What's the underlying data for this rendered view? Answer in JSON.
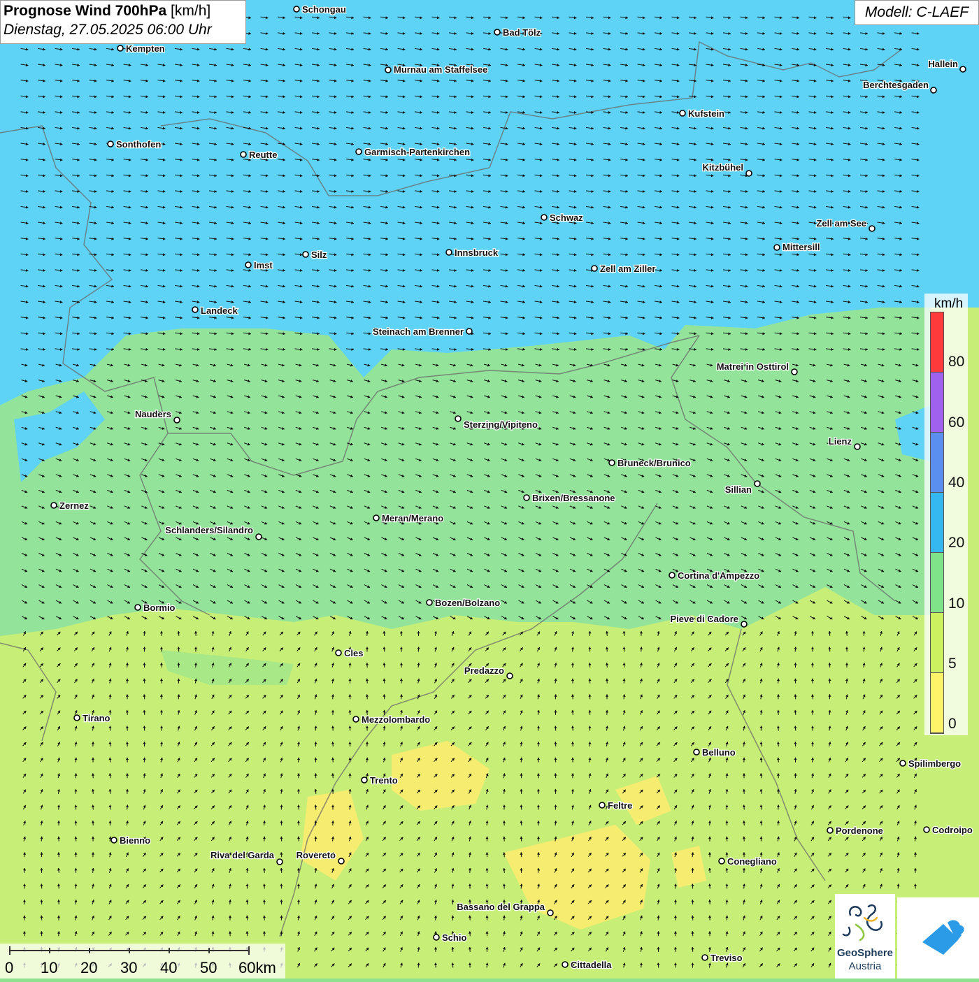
{
  "header": {
    "title_bold": "Prognose Wind 700hPa",
    "title_unit": "[km/h]",
    "datetime": "Dienstag, 27.05.2025 06:00 Uhr",
    "model": "Modell: C-LAEF"
  },
  "legend": {
    "unit": "km/h",
    "labels": [
      "80",
      "60",
      "40",
      "20",
      "10",
      "5",
      "0"
    ],
    "colors": [
      "#ff3a3a",
      "#a062ee",
      "#5a8ff0",
      "#35b8f0",
      "#7fe38a",
      "#cdf060",
      "#fff36a"
    ]
  },
  "scale_bar": {
    "labels": [
      "0",
      "10",
      "20",
      "30",
      "40",
      "50",
      "60km"
    ]
  },
  "cities": [
    {
      "name": "Schongau"
    },
    {
      "name": "Bad Tölz"
    },
    {
      "name": "Kempten"
    },
    {
      "name": "Murnau am Staffelsee"
    },
    {
      "name": "Hallein"
    },
    {
      "name": "Berchtesgaden"
    },
    {
      "name": "Kufstein"
    },
    {
      "name": "Sonthofen"
    },
    {
      "name": "Reutte"
    },
    {
      "name": "Garmisch-Partenkirchen"
    },
    {
      "name": "Kitzbühel"
    },
    {
      "name": "Schwaz"
    },
    {
      "name": "Zell am See"
    },
    {
      "name": "Mittersill"
    },
    {
      "name": "Innsbruck"
    },
    {
      "name": "Silz"
    },
    {
      "name": "Imst"
    },
    {
      "name": "Zell am Ziller"
    },
    {
      "name": "Landeck"
    },
    {
      "name": "Steinach am Brenner"
    },
    {
      "name": "Matrei in Osttirol"
    },
    {
      "name": "Nauders"
    },
    {
      "name": "Sterzing/Vipiteno"
    },
    {
      "name": "Lienz"
    },
    {
      "name": "Bruneck/Brunico"
    },
    {
      "name": "Sillian"
    },
    {
      "name": "Brixen/Bressanone"
    },
    {
      "name": "Zernez"
    },
    {
      "name": "Meran/Merano"
    },
    {
      "name": "Schlanders/Silandro"
    },
    {
      "name": "Cortina d'Ampezzo"
    },
    {
      "name": "Bozen/Bolzano"
    },
    {
      "name": "Bormio"
    },
    {
      "name": "Pieve di Cadore"
    },
    {
      "name": "Cles"
    },
    {
      "name": "Predazzo"
    },
    {
      "name": "Tirano"
    },
    {
      "name": "Mezzolombardo"
    },
    {
      "name": "Belluno"
    },
    {
      "name": "Spilimbergo"
    },
    {
      "name": "Trento"
    },
    {
      "name": "Feltre"
    },
    {
      "name": "Pordenone"
    },
    {
      "name": "Codroipo"
    },
    {
      "name": "Bienno"
    },
    {
      "name": "Riva del Garda"
    },
    {
      "name": "Rovereto"
    },
    {
      "name": "Conegliano"
    },
    {
      "name": "Bassano del Grappa"
    },
    {
      "name": "Schio"
    },
    {
      "name": "Treviso"
    },
    {
      "name": "Cittadella"
    }
  ],
  "logos": {
    "geosphere_line1": "GeoSphere",
    "geosphere_line2": "Austria"
  }
}
